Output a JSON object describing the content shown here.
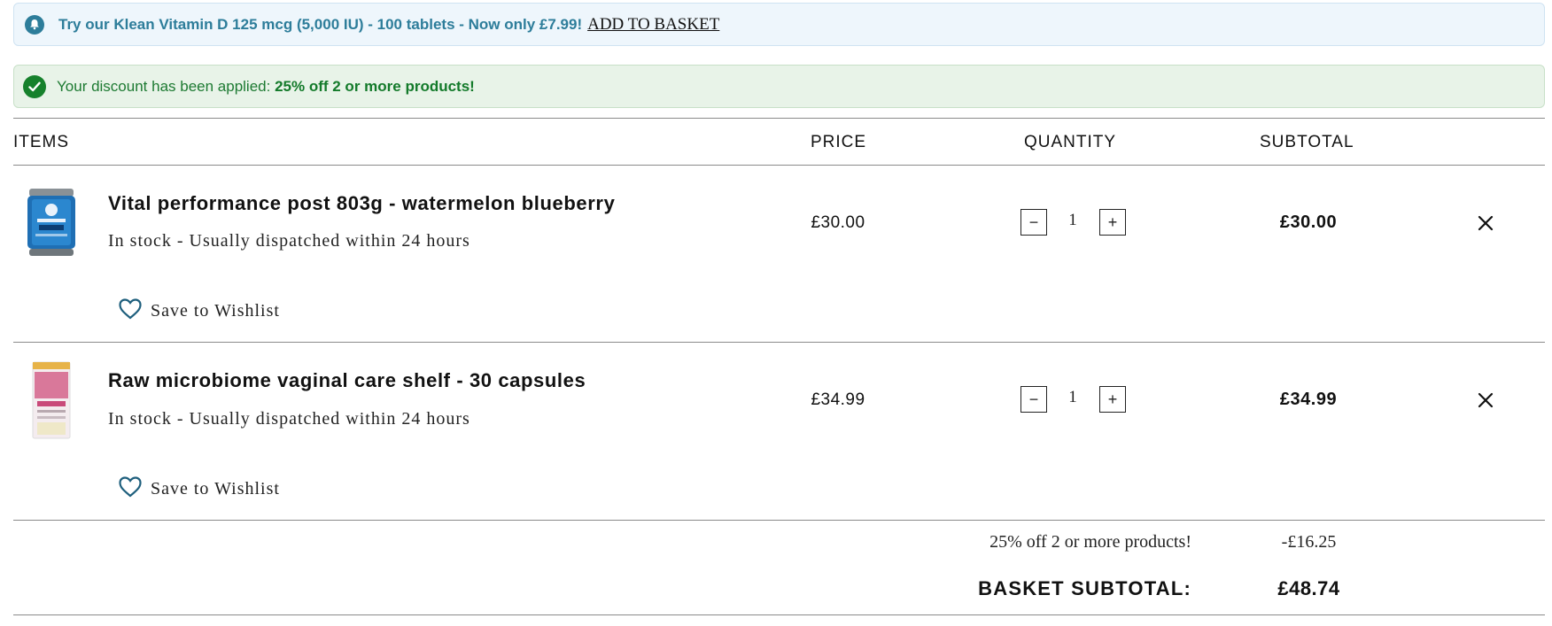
{
  "promo_banner": {
    "icon": "bell-icon",
    "text": "Try our Klean Vitamin D 125 mcg (5,000 IU) - 100 tablets - Now only £7.99!",
    "link": "ADD TO BASKET"
  },
  "discount_banner": {
    "icon": "check-circle-icon",
    "prefix": "Your discount has been applied:",
    "strong": "25% off 2 or more products!"
  },
  "table_headers": {
    "items": "ITEMS",
    "price": "PRICE",
    "quantity": "QUANTITY",
    "subtotal": "SUBTOTAL"
  },
  "items": [
    {
      "name": "Vital performance post 803g - watermelon blueberry",
      "stock": "In stock  -  Usually dispatched within 24 hours",
      "wishlist": "Save to Wishlist",
      "price": "£30.00",
      "quantity": "1",
      "decrement": "−",
      "increment": "+",
      "subtotal": "£30.00"
    },
    {
      "name": "Raw microbiome vaginal care shelf - 30 capsules",
      "stock": "In stock  -  Usually dispatched within 24 hours",
      "wishlist": "Save to Wishlist",
      "price": "£34.99",
      "quantity": "1",
      "decrement": "−",
      "increment": "+",
      "subtotal": "£34.99"
    }
  ],
  "summary": {
    "discount_label": "25% off 2 or more products!",
    "discount_amount": "-£16.25",
    "basket_label": "BASKET SUBTOTAL:",
    "basket_amount": "£48.74"
  },
  "colors": {
    "promo_text": "#2d7d9a",
    "discount_green": "#16812c",
    "rule": "#8a8a8a"
  }
}
